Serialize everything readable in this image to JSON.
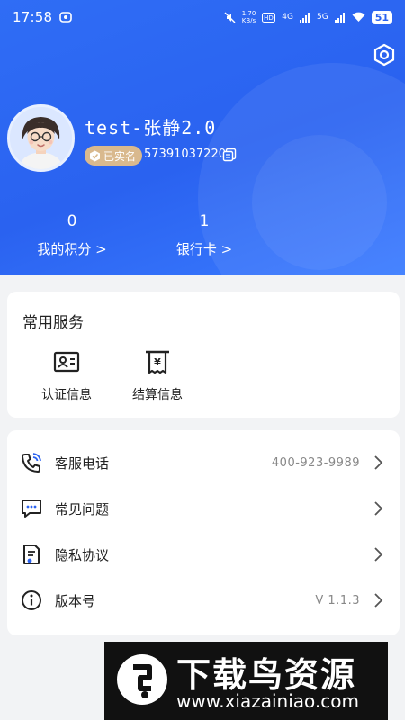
{
  "status_bar": {
    "time": "17:58",
    "speed_value": "1.70",
    "speed_unit": "KB/s",
    "net1": "4G",
    "net2": "5G",
    "battery": "51"
  },
  "profile": {
    "username": "test-张静2.0",
    "verified_label": "已实名",
    "user_id": "57391037220"
  },
  "stats": {
    "points": {
      "value": "0",
      "label": "我的积分 >"
    },
    "bank_card": {
      "value": "1",
      "label": "银行卡 >"
    }
  },
  "services": {
    "title": "常用服务",
    "items": [
      {
        "label": "认证信息",
        "icon": "id-card-icon"
      },
      {
        "label": "结算信息",
        "icon": "settlement-icon"
      }
    ]
  },
  "menu": {
    "items": [
      {
        "label": "客服电话",
        "value": "400-923-9989",
        "icon": "phone-icon"
      },
      {
        "label": "常见问题",
        "value": "",
        "icon": "message-icon"
      },
      {
        "label": "隐私协议",
        "value": "",
        "icon": "document-icon"
      },
      {
        "label": "版本号",
        "value": "V 1.1.3",
        "icon": "info-icon"
      }
    ]
  },
  "watermark": {
    "title": "下载鸟资源",
    "url": "www.xiazainiao.com"
  },
  "colors": {
    "header_blue": "#2a62f0",
    "badge_gold": "#d9b98e",
    "page_bg": "#f2f3f5"
  }
}
